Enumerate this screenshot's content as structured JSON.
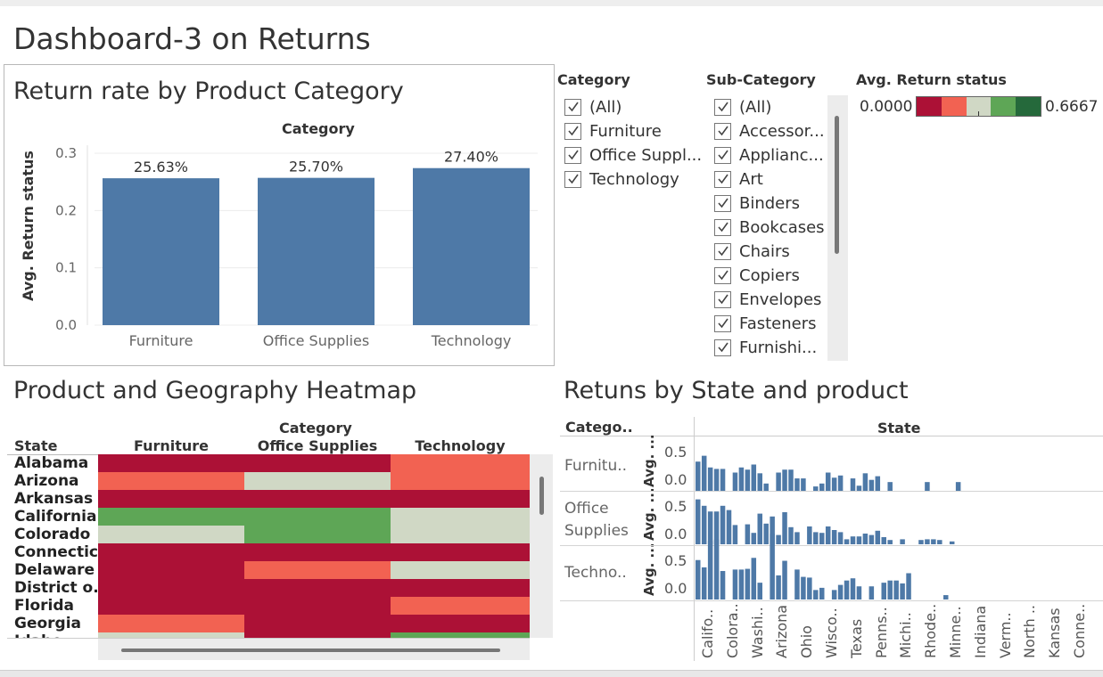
{
  "dashboard": {
    "title": "Dashboard-3 on Returns"
  },
  "bar_panel": {
    "title": "Return rate by Product Category",
    "header": "Category",
    "y_label": "Avg. Return status"
  },
  "filters": {
    "category": {
      "label": "Category",
      "items": [
        "(All)",
        "Furniture",
        "Office Suppl...",
        "Technology"
      ]
    },
    "subcategory": {
      "label": "Sub-Category",
      "items": [
        "(All)",
        "Accessor...",
        "Applianc...",
        "Art",
        "Binders",
        "Bookcases",
        "Chairs",
        "Copiers",
        "Envelopes",
        "Fasteners",
        "Furnishi..."
      ]
    }
  },
  "legend": {
    "title": "Avg. Return status",
    "min": "0.0000",
    "max": "0.6667",
    "colors": [
      "#ac1136",
      "#f26252",
      "#d0d8c5",
      "#5ea656",
      "#25693b"
    ]
  },
  "heatmap": {
    "title": "Product and Geography Heatmap",
    "header": "Category",
    "row_header": "State",
    "columns": [
      "Furniture",
      "Office Supplies",
      "Technology"
    ],
    "rows": [
      {
        "state": "Alabama",
        "levels": [
          0,
          0,
          1
        ]
      },
      {
        "state": "Arizona",
        "levels": [
          1,
          2,
          1
        ]
      },
      {
        "state": "Arkansas",
        "levels": [
          0,
          0,
          0
        ]
      },
      {
        "state": "California",
        "levels": [
          3,
          3,
          2
        ]
      },
      {
        "state": "Colorado",
        "levels": [
          2,
          3,
          2
        ]
      },
      {
        "state": "Connectic..",
        "levels": [
          0,
          0,
          0
        ]
      },
      {
        "state": "Delaware",
        "levels": [
          0,
          1,
          2
        ]
      },
      {
        "state": "District o..",
        "levels": [
          0,
          0,
          0
        ]
      },
      {
        "state": "Florida",
        "levels": [
          0,
          0,
          1
        ]
      },
      {
        "state": "Georgia",
        "levels": [
          1,
          0,
          0
        ]
      },
      {
        "state": "Idaho",
        "levels": [
          2,
          0,
          3
        ]
      }
    ]
  },
  "state_panel": {
    "title": "Retuns by State and product",
    "cat_header": "Catego..",
    "state_header": "State",
    "row_axis_label": "Avg. ...",
    "row_labels": [
      "Furnitu..",
      "Office\nSupplies",
      "Techno.."
    ],
    "tick_top": "0.5",
    "tick_bottom": "0.0",
    "states": [
      "Califo..",
      "Colora..",
      "Washi..",
      "Arizona",
      "Ohio",
      "Wisco..",
      "Texas",
      "Penns..",
      "Michi..",
      "Rhode..",
      "Minne..",
      "Indiana",
      "Verm..",
      "North ..",
      "Kansas",
      "Conne.."
    ]
  },
  "chart_data": [
    {
      "type": "bar",
      "title": "Return rate by Product Category",
      "xlabel": "Category",
      "ylabel": "Avg. Return status",
      "categories": [
        "Furniture",
        "Office Supplies",
        "Technology"
      ],
      "values": [
        0.2563,
        0.257,
        0.274
      ],
      "data_labels": [
        "25.63%",
        "25.70%",
        "27.40%"
      ],
      "ylim": [
        0,
        0.3
      ],
      "yticks": [
        "0.0",
        "0.1",
        "0.2",
        "0.3"
      ],
      "color": "#4e79a7"
    },
    {
      "type": "bar",
      "title": "Retuns by State and product",
      "xlabel": "State",
      "ylabel": "Avg. ...",
      "ylim": [
        0,
        0.5
      ],
      "series": [
        {
          "name": "Furnitu..",
          "values": [
            0.4,
            0.48,
            0.32,
            0.3,
            0.3,
            0,
            0.25,
            0.32,
            0.29,
            0.36,
            0.24,
            0.1,
            0,
            0.25,
            0.29,
            0.29,
            0.17,
            0.17,
            0,
            0.06,
            0.1,
            0.25,
            0.18,
            0.21,
            0,
            0.17,
            0.07,
            0.24,
            0.15,
            0.2,
            0,
            0.12,
            0,
            0,
            0,
            0,
            0,
            0.12,
            0,
            0,
            0,
            0,
            0.12,
            0
          ]
        },
        {
          "name": "Office Supplies",
          "values": [
            0.63,
            0.54,
            0.46,
            0.46,
            0.54,
            0.48,
            0.27,
            0,
            0.28,
            0.16,
            0.43,
            0.29,
            0.39,
            0.13,
            0.45,
            0.24,
            0.17,
            0,
            0.25,
            0.17,
            0.16,
            0.25,
            0.2,
            0.17,
            0.07,
            0.11,
            0.11,
            0.15,
            0.13,
            0.19,
            0.1,
            0.06,
            0,
            0.07,
            0,
            0,
            0.06,
            0.07,
            0.07,
            0.06,
            0,
            0.04,
            0,
            0
          ]
        },
        {
          "name": "Techno..",
          "values": [
            0.54,
            0.44,
            0.8,
            0.82,
            0.39,
            0,
            0.41,
            0.41,
            0.42,
            0.57,
            0.23,
            0,
            0.9,
            0.33,
            0.53,
            0,
            0.41,
            0.31,
            0.3,
            0.13,
            0.16,
            0,
            0.13,
            0.2,
            0.26,
            0.29,
            0.18,
            0,
            0.18,
            0,
            0.23,
            0.26,
            0.26,
            0.22,
            0.36,
            0,
            0,
            0,
            0,
            0,
            0.06,
            0,
            0,
            0
          ]
        }
      ]
    }
  ]
}
